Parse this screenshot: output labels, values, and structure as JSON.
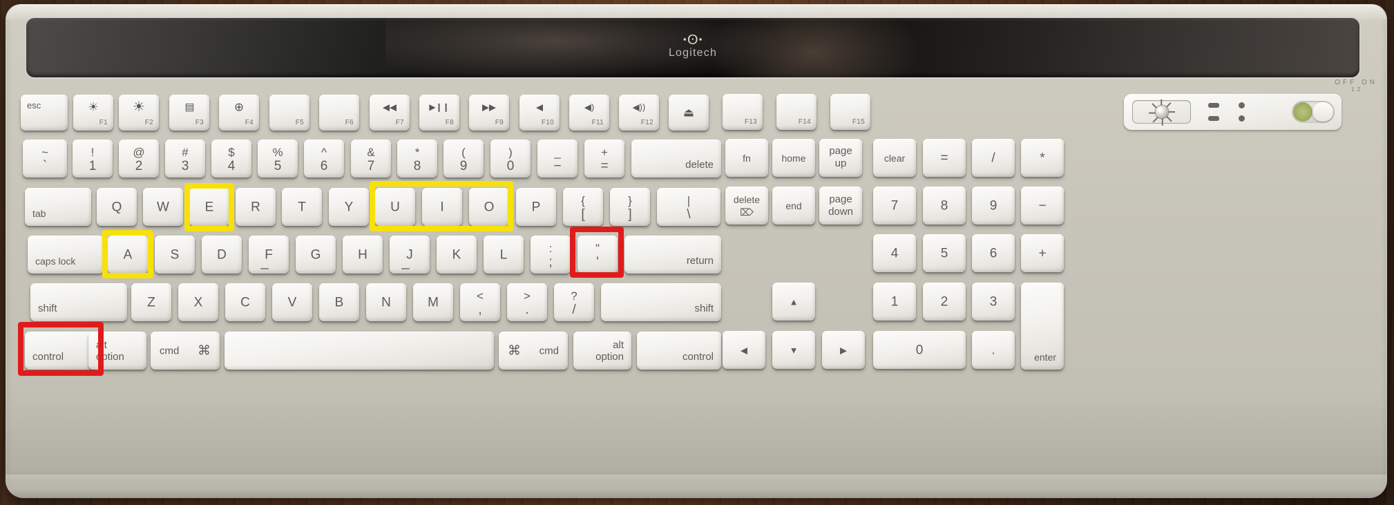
{
  "device": {
    "brand_mark": "ꞏʘꞏ",
    "brand_name": "Logitech",
    "panel_switch_label_off": "OFF",
    "panel_switch_label_on": "ON",
    "panel_switch_sub": "1 2",
    "brightness_icon": "brightness-dial-icon"
  },
  "highlights": {
    "yellow_color": "#f7e10a",
    "red_color": "#e01b1b",
    "boxes": [
      {
        "id": "highlight-key-e",
        "color": "yellow",
        "keys": [
          "E"
        ]
      },
      {
        "id": "highlight-keys-uio",
        "color": "yellow",
        "keys": [
          "U",
          "I",
          "O"
        ]
      },
      {
        "id": "highlight-key-a",
        "color": "yellow",
        "keys": [
          "A"
        ]
      },
      {
        "id": "highlight-key-quote",
        "color": "red",
        "keys": [
          "\" '"
        ]
      },
      {
        "id": "highlight-key-control",
        "color": "red",
        "keys": [
          "control"
        ]
      }
    ]
  },
  "rows": {
    "function_row": [
      {
        "name": "esc",
        "label": "esc"
      },
      {
        "name": "f1",
        "label": "",
        "glyph": "☀",
        "fn": "F1"
      },
      {
        "name": "f2",
        "label": "",
        "glyph": "☀",
        "fn": "F2"
      },
      {
        "name": "f3",
        "label": "",
        "glyph": "mission-control-icon",
        "fn": "F3"
      },
      {
        "name": "f4",
        "label": "",
        "glyph": "⊕",
        "fn": "F4"
      },
      {
        "name": "f5",
        "label": "",
        "glyph": "",
        "fn": "F5"
      },
      {
        "name": "f6",
        "label": "",
        "glyph": "",
        "fn": "F6"
      },
      {
        "name": "f7",
        "label": "",
        "glyph": "◀◀",
        "fn": "F7"
      },
      {
        "name": "f8",
        "label": "",
        "glyph": "▶❙❙",
        "fn": "F8"
      },
      {
        "name": "f9",
        "label": "",
        "glyph": "▶▶",
        "fn": "F9"
      },
      {
        "name": "f10",
        "label": "",
        "glyph": "◀",
        "fn": "F10"
      },
      {
        "name": "f11",
        "label": "",
        "glyph": "◀)",
        "fn": "F11"
      },
      {
        "name": "f12",
        "label": "",
        "glyph": "◀))",
        "fn": "F12"
      },
      {
        "name": "eject",
        "label": "",
        "glyph": "⏏",
        "fn": ""
      },
      {
        "name": "f13",
        "label": "",
        "glyph": "",
        "fn": "F13"
      },
      {
        "name": "f14",
        "label": "",
        "glyph": "",
        "fn": "F14"
      },
      {
        "name": "f15",
        "label": "",
        "glyph": "",
        "fn": "F15"
      }
    ],
    "number_row": [
      {
        "name": "tilde",
        "upper": "~",
        "lower": "`"
      },
      {
        "name": "one",
        "upper": "!",
        "lower": "1"
      },
      {
        "name": "two",
        "upper": "@",
        "lower": "2"
      },
      {
        "name": "three",
        "upper": "#",
        "lower": "3"
      },
      {
        "name": "four",
        "upper": "$",
        "lower": "4"
      },
      {
        "name": "five",
        "upper": "%",
        "lower": "5"
      },
      {
        "name": "six",
        "upper": "^",
        "lower": "6"
      },
      {
        "name": "seven",
        "upper": "&",
        "lower": "7"
      },
      {
        "name": "eight",
        "upper": "*",
        "lower": "8"
      },
      {
        "name": "nine",
        "upper": "(",
        "lower": "9"
      },
      {
        "name": "zero",
        "upper": ")",
        "lower": "0"
      },
      {
        "name": "minus",
        "upper": "_",
        "lower": "−"
      },
      {
        "name": "equal",
        "upper": "+",
        "lower": "="
      },
      {
        "name": "delete",
        "label": "delete"
      },
      {
        "name": "fn",
        "label": "fn"
      },
      {
        "name": "home",
        "label": "home"
      },
      {
        "name": "page-up",
        "l1": "page",
        "l2": "up"
      },
      {
        "name": "clear",
        "label": "clear"
      },
      {
        "name": "numpad-equal",
        "label": "="
      },
      {
        "name": "numpad-divide",
        "label": "/"
      },
      {
        "name": "numpad-multiply",
        "label": "*"
      }
    ],
    "top_letter_row": [
      {
        "name": "tab",
        "label": "tab"
      },
      {
        "name": "q",
        "label": "Q"
      },
      {
        "name": "w",
        "label": "W"
      },
      {
        "name": "e",
        "label": "E"
      },
      {
        "name": "r",
        "label": "R"
      },
      {
        "name": "t",
        "label": "T"
      },
      {
        "name": "y",
        "label": "Y"
      },
      {
        "name": "u",
        "label": "U"
      },
      {
        "name": "i",
        "label": "I"
      },
      {
        "name": "o",
        "label": "O"
      },
      {
        "name": "p",
        "label": "P"
      },
      {
        "name": "bracket-left",
        "upper": "{",
        "lower": "["
      },
      {
        "name": "bracket-right",
        "upper": "}",
        "lower": "]"
      },
      {
        "name": "backslash",
        "upper": "|",
        "lower": "\\"
      },
      {
        "name": "forward-delete",
        "l1": "delete",
        "l2": "⌦"
      },
      {
        "name": "end",
        "label": "end"
      },
      {
        "name": "page-down",
        "l1": "page",
        "l2": "down"
      },
      {
        "name": "numpad-7",
        "label": "7"
      },
      {
        "name": "numpad-8",
        "label": "8"
      },
      {
        "name": "numpad-9",
        "label": "9"
      },
      {
        "name": "numpad-minus",
        "label": "−"
      }
    ],
    "home_row": [
      {
        "name": "caps-lock",
        "label": "caps lock"
      },
      {
        "name": "a",
        "label": "A"
      },
      {
        "name": "s",
        "label": "S"
      },
      {
        "name": "d",
        "label": "D"
      },
      {
        "name": "f",
        "label": "F"
      },
      {
        "name": "g",
        "label": "G"
      },
      {
        "name": "h",
        "label": "H"
      },
      {
        "name": "j",
        "label": "J"
      },
      {
        "name": "k",
        "label": "K"
      },
      {
        "name": "l",
        "label": "L"
      },
      {
        "name": "semicolon",
        "upper": ":",
        "lower": ";"
      },
      {
        "name": "quote",
        "upper": "\"",
        "lower": "'"
      },
      {
        "name": "return",
        "label": "return"
      },
      {
        "name": "numpad-4",
        "label": "4"
      },
      {
        "name": "numpad-5",
        "label": "5"
      },
      {
        "name": "numpad-6",
        "label": "6"
      },
      {
        "name": "numpad-plus",
        "label": "+"
      }
    ],
    "bottom_letter_row": [
      {
        "name": "shift-left",
        "label": "shift"
      },
      {
        "name": "z",
        "label": "Z"
      },
      {
        "name": "x",
        "label": "X"
      },
      {
        "name": "c",
        "label": "C"
      },
      {
        "name": "v",
        "label": "V"
      },
      {
        "name": "b",
        "label": "B"
      },
      {
        "name": "n",
        "label": "N"
      },
      {
        "name": "m",
        "label": "M"
      },
      {
        "name": "comma",
        "upper": "<",
        "lower": ","
      },
      {
        "name": "period",
        "upper": ">",
        "lower": "."
      },
      {
        "name": "slash",
        "upper": "?",
        "lower": "/"
      },
      {
        "name": "shift-right",
        "label": "shift"
      },
      {
        "name": "arrow-up",
        "label": "▲"
      },
      {
        "name": "numpad-1",
        "label": "1"
      },
      {
        "name": "numpad-2",
        "label": "2"
      },
      {
        "name": "numpad-3",
        "label": "3"
      },
      {
        "name": "numpad-enter",
        "label": "enter"
      }
    ],
    "modifier_row": [
      {
        "name": "control-left",
        "label": "control"
      },
      {
        "name": "option-left",
        "l1": "alt",
        "l2": "option"
      },
      {
        "name": "cmd-left",
        "left": "cmd",
        "right": "⌘"
      },
      {
        "name": "space",
        "label": ""
      },
      {
        "name": "cmd-right",
        "left": "⌘",
        "right": "cmd"
      },
      {
        "name": "option-right",
        "l1": "alt",
        "l2": "option"
      },
      {
        "name": "control-right",
        "label": "control"
      },
      {
        "name": "arrow-left",
        "label": "◀"
      },
      {
        "name": "arrow-down",
        "label": "▼"
      },
      {
        "name": "arrow-right",
        "label": "▶"
      },
      {
        "name": "numpad-0",
        "label": "0"
      },
      {
        "name": "numpad-period",
        "label": "."
      }
    ]
  }
}
